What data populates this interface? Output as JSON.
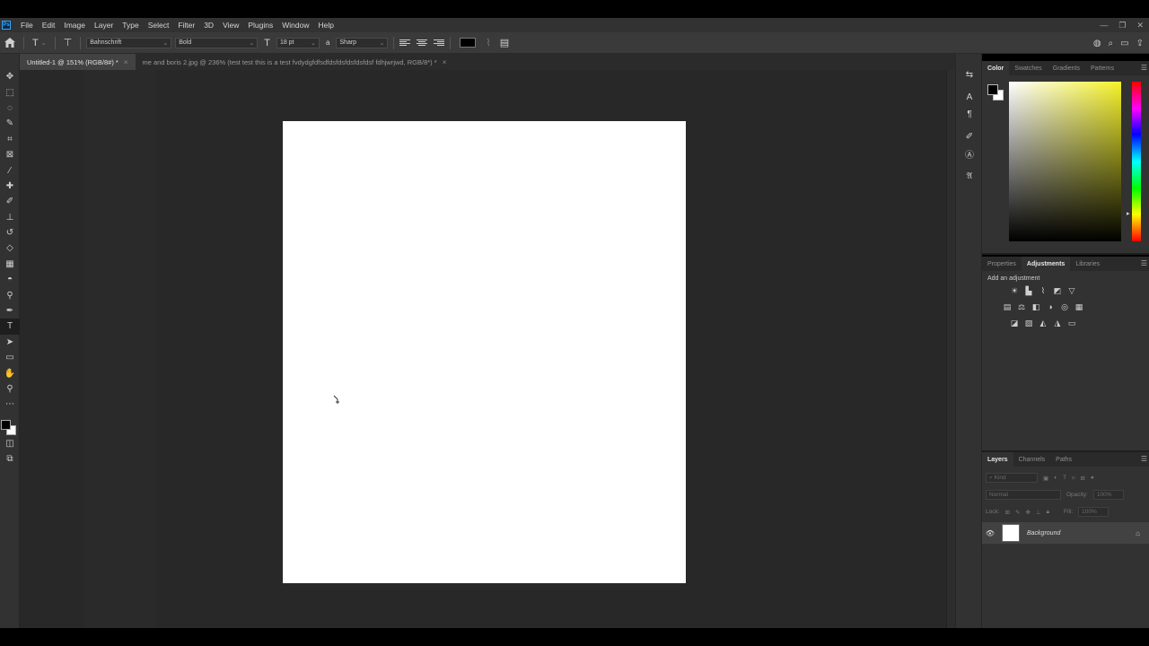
{
  "app": {
    "logo": "Ps",
    "menu": [
      "File",
      "Edit",
      "Image",
      "Layer",
      "Type",
      "Select",
      "Filter",
      "3D",
      "View",
      "Plugins",
      "Window",
      "Help"
    ],
    "window_controls": [
      "—",
      "❐",
      "✕"
    ]
  },
  "options_bar": {
    "font_family": "Bahnschrift",
    "font_style": "Bold",
    "font_size": "18 pt",
    "antialias": "Sharp",
    "text_color": "#000000"
  },
  "tabs": [
    {
      "label": "Untitled-1 @ 151% (RGB/8#) *",
      "active": true
    },
    {
      "label": "me and boris 2.jpg @ 236% (test test this is a test fvdydgfdfsdfdsfdsfdsfdsfdsf fdhjwrjwd, RGB/8*) *",
      "active": false
    }
  ],
  "panels": {
    "color": {
      "tabs": [
        "Color",
        "Swatches",
        "Gradients",
        "Patterns"
      ],
      "active_tab": "Color",
      "foreground": "#000000",
      "background": "#ffffff"
    },
    "adjustments": {
      "tabs": [
        "Properties",
        "Adjustments",
        "Libraries"
      ],
      "active_tab": "Adjustments",
      "label": "Add an adjustment"
    },
    "layers": {
      "tabs": [
        "Layers",
        "Channels",
        "Paths"
      ],
      "active_tab": "Layers",
      "filter_placeholder": "Kind",
      "blend_mode": "Normal",
      "opacity_label": "Opacity:",
      "opacity_value": "100%",
      "lock_label": "Lock:",
      "fill_label": "Fill:",
      "fill_value": "100%",
      "layer_name": "Background"
    }
  }
}
